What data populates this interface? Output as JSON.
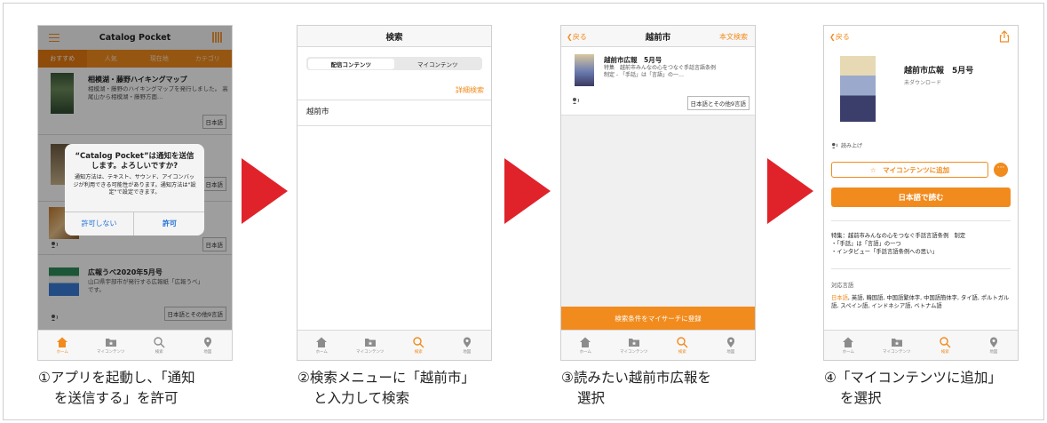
{
  "panel1": {
    "title": "Catalog Pocket",
    "tabs": [
      "おすすめ",
      "人気",
      "現在地",
      "カテゴリ"
    ],
    "items": [
      {
        "title": "相模湖・藤野ハイキングマップ",
        "desc": "相模湖・藤野のハイキングマップを発行しました。 高尾山から相模湖・藤野方面…",
        "badge": "日本語"
      },
      {
        "title": "",
        "desc": "",
        "badge": "日本語"
      },
      {
        "title": "",
        "desc": "",
        "badge": "日本語"
      },
      {
        "title": "広報うべ2020年5月号",
        "desc": "山口県宇部市が発行する広報紙「広報うべ」です。",
        "badge": "日本語とその他9言語"
      }
    ],
    "dialog": {
      "title": "“Catalog Pocket”は通知を送信します。よろしいですか?",
      "message": "通知方法は、テキスト、サウンド、アイコンバッジが利用できる可能性があります。通知方法は\"設定\"で設定できます。",
      "deny": "許可しない",
      "allow": "許可"
    }
  },
  "tabbar": {
    "home": "ホーム",
    "mycontents": "マイコンテンツ",
    "search": "検索",
    "map": "地図"
  },
  "panel2": {
    "title": "検索",
    "seg_left": "配信コンテンツ",
    "seg_right": "マイコンテンツ",
    "advanced": "詳細検索",
    "query": "越前市"
  },
  "panel3": {
    "back": "戻る",
    "title": "越前市",
    "right": "本文検索",
    "result_title": "越前市広報　5月号",
    "result_desc": "特集　越前市みんなの心をつなぐ手話言語条例　制定 - 「手話」は「言語」の一…",
    "badge": "日本語とその他9言語",
    "register": "検索条件をマイサーチに登録"
  },
  "panel4": {
    "back": "戻る",
    "title": "越前市広報　5月号",
    "status": "未ダウンロード",
    "readaloud": "読み上げ",
    "add_button": "☆　マイコンテンツに追加",
    "read_button": "日本語で読む",
    "feature": "特集：越前市みんなの心をつなぐ手話言語条例　制定\n・「手話」は「言語」の一つ\n・インタビュー「手話言語条例への思い」",
    "lang_label": "対応言語",
    "lang_current": "日本語",
    "lang_rest": ", 英語, 韓国語, 中国語繁体字, 中国語簡体字, タイ語, ポルトガル語, スペイン語, インドネシア語, ベトナム語"
  },
  "captions": {
    "c1_l1": "①アプリを起動し、「通知",
    "c1_l2": "を送信する」を許可",
    "c2_l1": "②検索メニューに「越前市」",
    "c2_l2": "と入力して検索",
    "c3_l1": "③読みたい越前市広報を",
    "c3_l2": "選択",
    "c4_l1": "④「マイコンテンツに追加」",
    "c4_l2": "を選択"
  },
  "colors": {
    "accent": "#f18b1e",
    "arrow": "#e0232a"
  }
}
